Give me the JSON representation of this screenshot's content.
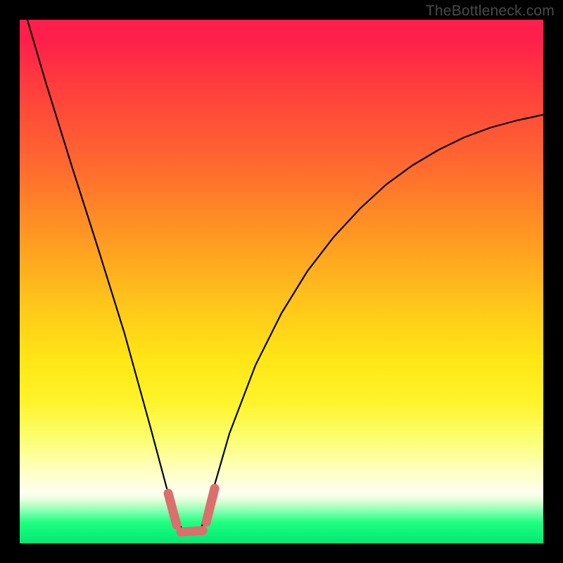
{
  "watermark": "TheBottleneck.com",
  "chart_data": {
    "type": "line",
    "title": "",
    "xlabel": "",
    "ylabel": "",
    "xlim": [
      0,
      1
    ],
    "ylim": [
      0,
      1
    ],
    "series": [
      {
        "name": "bottleneck-curve",
        "x": [
          0.0,
          0.05,
          0.1,
          0.15,
          0.2,
          0.25,
          0.29,
          0.31,
          0.33,
          0.345,
          0.36,
          0.4,
          0.45,
          0.5,
          0.55,
          0.6,
          0.65,
          0.7,
          0.75,
          0.8,
          0.85,
          0.9,
          0.95,
          1.0
        ],
        "y": [
          1.05,
          0.88,
          0.72,
          0.56,
          0.4,
          0.22,
          0.07,
          0.025,
          0.02,
          0.025,
          0.07,
          0.21,
          0.34,
          0.44,
          0.52,
          0.585,
          0.64,
          0.685,
          0.722,
          0.752,
          0.775,
          0.795,
          0.808,
          0.818
        ]
      }
    ],
    "annotations": [
      {
        "name": "left-marker-segment",
        "x": [
          0.283,
          0.3
        ],
        "y": [
          0.095,
          0.035
        ],
        "color": "#da6f6d"
      },
      {
        "name": "floor-marker-segment",
        "x": [
          0.308,
          0.35
        ],
        "y": [
          0.022,
          0.024
        ],
        "color": "#da6f6d"
      },
      {
        "name": "right-marker-segment",
        "x": [
          0.356,
          0.372
        ],
        "y": [
          0.04,
          0.105
        ],
        "color": "#da6f6d"
      }
    ],
    "background_gradient": {
      "top": "#ff1f4b",
      "mid": "#ffe616",
      "bottom": "#00e874"
    }
  }
}
